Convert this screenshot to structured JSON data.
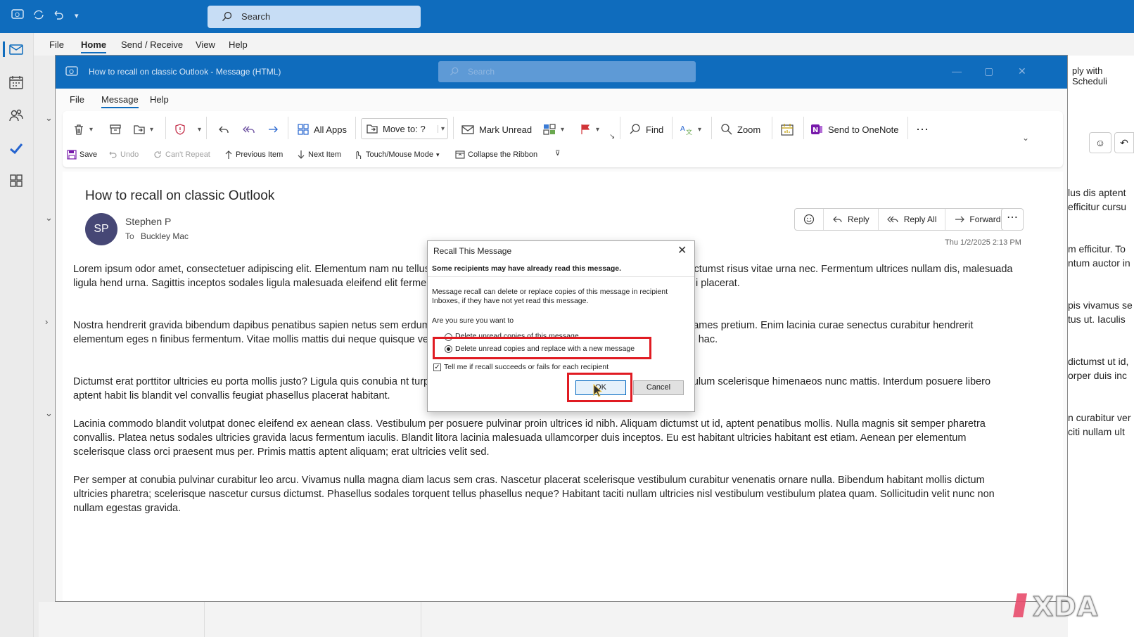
{
  "app": {
    "search_placeholder": "Search",
    "menu": [
      "File",
      "Home",
      "Send / Receive",
      "View",
      "Help"
    ],
    "active_menu": "Home",
    "right_peek_text": [
      "ply with Scheduli"
    ]
  },
  "right_pane_text": [
    "lus dis aptent",
    "efficitur cursu",
    "m efficitur. To",
    "ntum auctor in",
    "pis vivamus se",
    "tus ut. Iaculis",
    "dictumst ut id,",
    "orper duis inc",
    "n curabitur ver",
    "citi nullam ult"
  ],
  "message_window": {
    "title": "How to recall on classic Outlook  -  Message (HTML)",
    "search_placeholder": "Search",
    "menu": [
      "File",
      "Message",
      "Help"
    ],
    "active_menu": "Message",
    "ribbon": {
      "all_apps": "All Apps",
      "move_to": "Move to: ?",
      "mark_unread": "Mark Unread",
      "find": "Find",
      "zoom": "Zoom",
      "send_to_onenote": "Send to OneNote"
    },
    "quick_access": {
      "save": "Save",
      "undo": "Undo",
      "cant_repeat": "Can't Repeat",
      "previous_item": "Previous Item",
      "next_item": "Next Item",
      "touch_mouse_mode": "Touch/Mouse Mode",
      "collapse_ribbon": "Collapse the Ribbon"
    }
  },
  "email": {
    "subject": "How to recall on classic Outlook",
    "avatar_initials": "SP",
    "sender": "Stephen P",
    "to_label": "To",
    "to_name": "Buckley Mac",
    "date": "Thu 1/2/2025 2:13 PM",
    "actions": {
      "reply": "Reply",
      "reply_all": "Reply All",
      "forward": "Forward"
    },
    "paragraphs": [
      "Lorem ipsum odor amet, consectetuer adipiscing elit. Elementum nam nu                                                                                                        tellus dis aptent justo dui feugiat donec. Diam venenatis amet dictumst risus vitae urna nec. Fermentum ultrices nullam dis, malesuada ligula hend                                                                                                  urna. Sagittis inceptos sodales ligula malesuada eleifend elit fermentum dolor. Mus sem lacus pharetra rhoncus metus porta mi placerat.",
      "Nostra hendrerit gravida bibendum dapibus penatibus sapien netus sem                                                                                                      erdum efficitur. Torquent rutrum nibh curabitur taciti nec semper fames pretium. Enim lacinia curae senectus curabitur hendrerit elementum eges                                                                                                     n finibus fermentum. Vitae mollis mattis dui neque quisque velit donec. Porta maecenas magnis vulputate luctus per odio hac.",
      "Dictumst erat porttitor ultricies eu porta mollis justo? Ligula quis conubia                                                                                                    nt turpis vivamus sed egestas ridiculus eu. Cubilia ultricies vestibulum scelerisque himenaeos nunc mattis. Interdum posuere libero aptent habit                                                                                                   lis blandit vel convallis feugiat phasellus placerat habitant.",
      "Lacinia commodo blandit volutpat donec eleifend ex aenean class. Vestibulum per posuere pulvinar proin ultrices id nibh. Aliquam dictumst ut id, aptent penatibus mollis. Nulla magnis sit semper pharetra convallis. Platea netus sodales ultricies gravida lacus fermentum iaculis. Blandit litora lacinia malesuada ullamcorper duis inceptos. Eu est habitant ultricies habitant est etiam. Aenean per elementum scelerisque class orci praesent mus per. Primis mattis aptent aliquam; erat ultricies velit sed.",
      "Per semper at conubia pulvinar curabitur leo arcu. Vivamus nulla magna diam lacus sem cras. Nascetur placerat scelerisque vestibulum curabitur venenatis ornare nulla. Bibendum habitant mollis dictum ultricies pharetra; scelerisque nascetur cursus dictumst. Phasellus sodales torquent tellus phasellus neque? Habitant taciti nullam ultricies nisl vestibulum vestibulum platea quam. Sollicitudin velit nunc non nullam egestas gravida."
    ]
  },
  "dialog": {
    "title": "Recall This Message",
    "warning": "Some recipients may have already read this message.",
    "description": "Message recall can delete or replace copies of this message in recipient Inboxes, if they have not yet read this message.",
    "question": "Are you sure you want to",
    "option_delete": "Delete unread copies of this message",
    "option_replace": "Delete unread copies and replace with a new message",
    "selected_option": "option_replace",
    "checkbox_label": "Tell me if recall succeeds or fails for each recipient",
    "checkbox_checked": true,
    "ok": "OK",
    "cancel": "Cancel"
  },
  "watermark": "XDA",
  "colors": {
    "brand_blue": "#0f6cbd",
    "highlight_red": "#e01b22",
    "avatar": "#464775"
  }
}
